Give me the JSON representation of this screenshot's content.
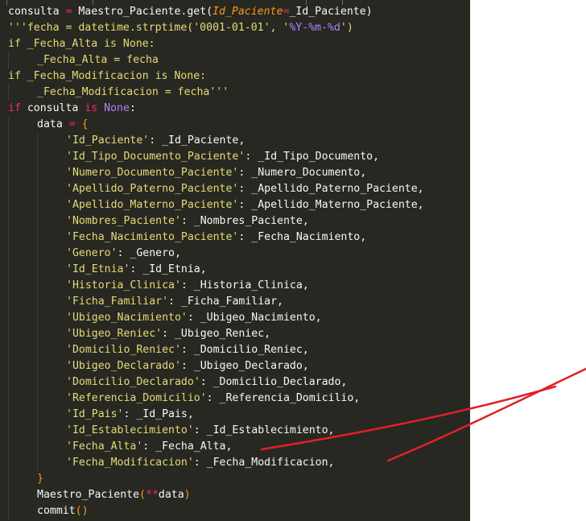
{
  "editor": {
    "lines": [
      {
        "indent": 0,
        "tokens": [
          [
            "consulta",
            "plain"
          ],
          [
            " = ",
            "op"
          ],
          [
            "Maestro_Paciente.get(",
            "plain"
          ],
          [
            "Id_Paciente",
            "param"
          ],
          [
            "=",
            "op"
          ],
          [
            "_Id_Paciente)",
            "plain"
          ]
        ]
      },
      {
        "indent": 0,
        "tokens": [
          [
            "'''fecha = datetime.strptime('0001-01-01', '",
            "cm"
          ],
          [
            "%Y-%m-%d",
            "const"
          ],
          [
            "')",
            "cm"
          ]
        ]
      },
      {
        "indent": 0,
        "tokens": [
          [
            "if _Fecha_Alta is None:",
            "cm"
          ]
        ]
      },
      {
        "indent": 1,
        "tokens": [
          [
            "_Fecha_Alta = fecha",
            "cm"
          ]
        ]
      },
      {
        "indent": 0,
        "tokens": [
          [
            "if _Fecha_Modificacion is None:",
            "cm"
          ]
        ]
      },
      {
        "indent": 1,
        "tokens": [
          [
            "_Fecha_Modificacion = fecha'''",
            "cm"
          ]
        ]
      },
      {
        "indent": 0,
        "tokens": [
          [
            "if",
            "kw"
          ],
          [
            " consulta ",
            "plain"
          ],
          [
            "is",
            "kw"
          ],
          [
            " ",
            "plain"
          ],
          [
            "None",
            "const"
          ],
          [
            ":",
            "plain"
          ]
        ]
      },
      {
        "indent": 1,
        "tokens": [
          [
            "data",
            "plain"
          ],
          [
            " = ",
            "op"
          ],
          [
            "{",
            "br"
          ]
        ]
      },
      {
        "indent": 2,
        "tokens": [
          [
            "'Id_Paciente'",
            "str"
          ],
          [
            ": _Id_Paciente,",
            "plain"
          ]
        ]
      },
      {
        "indent": 2,
        "tokens": [
          [
            "'Id_Tipo_Documento_Paciente'",
            "str"
          ],
          [
            ": _Id_Tipo_Documento,",
            "plain"
          ]
        ]
      },
      {
        "indent": 2,
        "tokens": [
          [
            "'Numero_Documento_Paciente'",
            "str"
          ],
          [
            ": _Numero_Documento,",
            "plain"
          ]
        ]
      },
      {
        "indent": 2,
        "tokens": [
          [
            "'Apellido_Paterno_Paciente'",
            "str"
          ],
          [
            ": _Apellido_Paterno_Paciente,",
            "plain"
          ]
        ]
      },
      {
        "indent": 2,
        "tokens": [
          [
            "'Apellido_Materno_Paciente'",
            "str"
          ],
          [
            ": _Apellido_Materno_Paciente,",
            "plain"
          ]
        ]
      },
      {
        "indent": 2,
        "tokens": [
          [
            "'Nombres_Paciente'",
            "str"
          ],
          [
            ": _Nombres_Paciente,",
            "plain"
          ]
        ]
      },
      {
        "indent": 2,
        "tokens": [
          [
            "'Fecha_Nacimiento_Paciente'",
            "str"
          ],
          [
            ": _Fecha_Nacimiento,",
            "plain"
          ]
        ]
      },
      {
        "indent": 2,
        "tokens": [
          [
            "'Genero'",
            "str"
          ],
          [
            ": _Genero,",
            "plain"
          ]
        ]
      },
      {
        "indent": 2,
        "tokens": [
          [
            "'Id_Etnia'",
            "str"
          ],
          [
            ": _Id_Etnia,",
            "plain"
          ]
        ]
      },
      {
        "indent": 2,
        "tokens": [
          [
            "'Historia_Clinica'",
            "str"
          ],
          [
            ": _Historia_Clinica,",
            "plain"
          ]
        ]
      },
      {
        "indent": 2,
        "tokens": [
          [
            "'Ficha_Familiar'",
            "str"
          ],
          [
            ": _Ficha_Familiar,",
            "plain"
          ]
        ]
      },
      {
        "indent": 2,
        "tokens": [
          [
            "'Ubigeo_Nacimiento'",
            "str"
          ],
          [
            ": _Ubigeo_Nacimiento,",
            "plain"
          ]
        ]
      },
      {
        "indent": 2,
        "tokens": [
          [
            "'Ubigeo_Reniec'",
            "str"
          ],
          [
            ": _Ubigeo_Reniec,",
            "plain"
          ]
        ]
      },
      {
        "indent": 2,
        "tokens": [
          [
            "'Domicilio_Reniec'",
            "str"
          ],
          [
            ": _Domicilio_Reniec,",
            "plain"
          ]
        ]
      },
      {
        "indent": 2,
        "tokens": [
          [
            "'Ubigeo_Declarado'",
            "str"
          ],
          [
            ": _Ubigeo_Declarado,",
            "plain"
          ]
        ]
      },
      {
        "indent": 2,
        "tokens": [
          [
            "'Domicilio_Declarado'",
            "str"
          ],
          [
            ": _Domicilio_Declarado,",
            "plain"
          ]
        ]
      },
      {
        "indent": 2,
        "tokens": [
          [
            "'Referencia_Domicilio'",
            "str"
          ],
          [
            ": _Referencia_Domicilio,",
            "plain"
          ]
        ]
      },
      {
        "indent": 2,
        "tokens": [
          [
            "'Id_Pais'",
            "str"
          ],
          [
            ": _Id_Pais,",
            "plain"
          ]
        ]
      },
      {
        "indent": 2,
        "tokens": [
          [
            "'Id_Establecimiento'",
            "str"
          ],
          [
            ": _Id_Establecimiento,",
            "plain"
          ]
        ]
      },
      {
        "indent": 2,
        "tokens": [
          [
            "'Fecha_Alta'",
            "str"
          ],
          [
            ": _Fecha_Alta,",
            "plain"
          ]
        ]
      },
      {
        "indent": 2,
        "tokens": [
          [
            "'Fecha_Modificacion'",
            "str"
          ],
          [
            ": _Fecha_Modificacion,",
            "plain"
          ]
        ]
      },
      {
        "indent": 1,
        "tokens": [
          [
            "}",
            "br"
          ]
        ]
      },
      {
        "indent": 1,
        "tokens": [
          [
            "Maestro_Paciente",
            "plain"
          ],
          [
            "(",
            "br"
          ],
          [
            "**",
            "op"
          ],
          [
            "data",
            "plain"
          ],
          [
            ")",
            "br"
          ]
        ]
      },
      {
        "indent": 1,
        "tokens": [
          [
            "commit",
            "plain"
          ],
          [
            "()",
            "br"
          ]
        ]
      }
    ]
  },
  "colors": {
    "editor_bg": "#272822",
    "annotation": "#e0202a"
  }
}
